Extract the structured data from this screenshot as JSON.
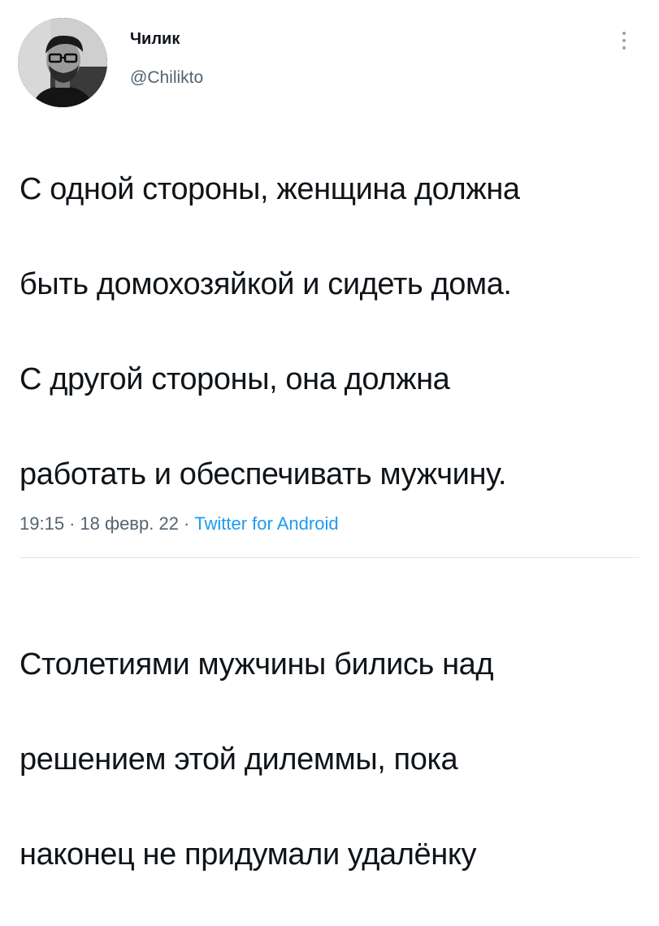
{
  "author": {
    "display_name": "Чилик",
    "handle": "@Chiliktо",
    "avatar_icon": "user-avatar"
  },
  "more_icon": "more-vertical-icon",
  "tweet": {
    "paragraph_1": [
      "С одной стороны, женщина должна",
      "быть домохозяйкой и сидеть дома.",
      "С другой стороны, она должна",
      "работать и обеспечивать мужчину."
    ],
    "paragraph_2": [
      "Столетиями мужчины бились над",
      "решением этой дилеммы, пока",
      "наконец не придумали удалёнку"
    ]
  },
  "meta": {
    "time": "19:15",
    "separator": "·",
    "date": "18 февр. 22",
    "source": "Twitter for Android"
  },
  "colors": {
    "text": "#0f1419",
    "secondary": "#536471",
    "accent": "#1d9bf0",
    "divider": "#e3e7ea"
  }
}
